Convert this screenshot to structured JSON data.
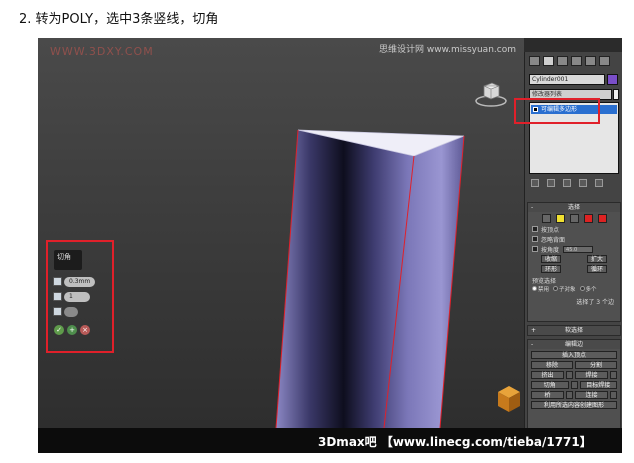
{
  "heading": "2. 转为POLY，选中3条竖线，切角",
  "viewport": {
    "watermark_left": "WWW.3DXY.COM",
    "watermark_right": "思维设计网 www.missyuan.com"
  },
  "caddy": {
    "title": "切角",
    "amount": "0.3mm",
    "segments": "1",
    "open": "",
    "ok_icon": "check-icon",
    "apply_icon": "plus-icon",
    "cancel_icon": "x-icon"
  },
  "panel": {
    "object_name": "Cylinder001",
    "modifier_list": "修改器列表",
    "stack_item": "可编辑多边形",
    "selection": {
      "title": "选择",
      "by_vertex": "按顶点",
      "ignore_backfacing": "忽略背面",
      "by_angle": "按角度",
      "angle_value": "45.0",
      "shrink": "收缩",
      "grow": "扩大",
      "ring": "环形",
      "loop": "循环",
      "preview_label": "预览选择",
      "preview_off": "禁用",
      "preview_sub": "子对象",
      "preview_multi": "多个",
      "status": "选择了 3 个边"
    },
    "soft_selection": "软选择",
    "edit_edges": {
      "title": "编辑边",
      "insert_vertex": "插入顶点",
      "remove": "移除",
      "split": "分割",
      "extrude": "挤出",
      "weld": "焊接",
      "chamfer": "切角",
      "target_weld": "目标焊接",
      "bridge": "桥",
      "connect": "连接",
      "create_shape": "利用所选内容创建图形"
    }
  },
  "footer": "3Dmax吧 【www.linecg.com/tieba/1771】"
}
